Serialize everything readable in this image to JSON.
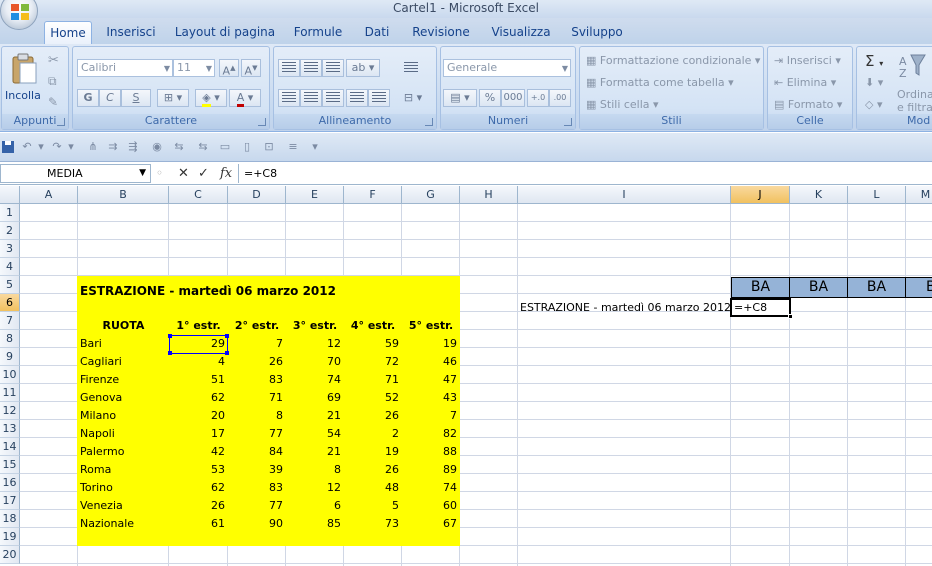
{
  "window": {
    "title": "Cartel1 - Microsoft Excel"
  },
  "tabs": [
    "Home",
    "Inserisci",
    "Layout di pagina",
    "Formule",
    "Dati",
    "Revisione",
    "Visualizza",
    "Sviluppo"
  ],
  "ribbon": {
    "appunti": {
      "label": "Appunti",
      "paste": "Incolla"
    },
    "carattere": {
      "label": "Carattere",
      "font": "Calibri",
      "size": "11",
      "bold": "G",
      "italic": "C",
      "underline": "S"
    },
    "allineamento": {
      "label": "Allineamento"
    },
    "numeri": {
      "label": "Numeri",
      "format": "Generale",
      "percent": "%",
      "thousands": "000"
    },
    "stili": {
      "label": "Stili",
      "conditional": "Formattazione condizionale",
      "table": "Formatta come tabella",
      "cell": "Stili cella"
    },
    "celle": {
      "label": "Celle",
      "insert": "Inserisci",
      "delete": "Elimina",
      "format": "Formato"
    },
    "modifica": {
      "label": "Mod",
      "sort": "Ordina",
      "filter": "e filtra"
    }
  },
  "formula_bar": {
    "name_box": "MEDIA",
    "fx": "fx",
    "formula": "=+C8"
  },
  "columns": [
    "A",
    "B",
    "C",
    "D",
    "E",
    "F",
    "G",
    "H",
    "I",
    "J",
    "K",
    "L",
    "M"
  ],
  "rows": [
    "1",
    "2",
    "3",
    "4",
    "5",
    "6",
    "7",
    "8",
    "9",
    "10",
    "11",
    "12",
    "13",
    "14",
    "15",
    "16",
    "17",
    "18",
    "19",
    "20"
  ],
  "sheet": {
    "title": "ESTRAZIONE - martedì 06 marzo 2012",
    "headers": [
      "RUOTA",
      "1° estr.",
      "2° estr.",
      "3° estr.",
      "4° estr.",
      "5° estr."
    ],
    "data": [
      {
        "ruota": "Bari",
        "v": [
          29,
          7,
          12,
          59,
          19
        ]
      },
      {
        "ruota": "Cagliari",
        "v": [
          4,
          26,
          70,
          72,
          46
        ]
      },
      {
        "ruota": "Firenze",
        "v": [
          51,
          83,
          74,
          71,
          47
        ]
      },
      {
        "ruota": "Genova",
        "v": [
          62,
          71,
          69,
          52,
          43
        ]
      },
      {
        "ruota": "Milano",
        "v": [
          20,
          8,
          21,
          26,
          7
        ]
      },
      {
        "ruota": "Napoli",
        "v": [
          17,
          77,
          54,
          2,
          82
        ]
      },
      {
        "ruota": "Palermo",
        "v": [
          42,
          84,
          21,
          19,
          88
        ]
      },
      {
        "ruota": "Roma",
        "v": [
          53,
          39,
          8,
          26,
          89
        ]
      },
      {
        "ruota": "Torino",
        "v": [
          62,
          83,
          12,
          48,
          74
        ]
      },
      {
        "ruota": "Venezia",
        "v": [
          26,
          77,
          6,
          5,
          60
        ]
      },
      {
        "ruota": "Nazionale",
        "v": [
          61,
          90,
          85,
          73,
          67
        ]
      }
    ],
    "i6": "ESTRAZIONE - martedì 06 marzo 2012",
    "ba_headers": [
      "BA",
      "BA",
      "BA",
      "B"
    ],
    "active_cell_value": "=+C8"
  },
  "colors": {
    "highlight": "#ffff00",
    "ba_header": "#95b3d7",
    "ribbon": "#c5d8ef"
  }
}
